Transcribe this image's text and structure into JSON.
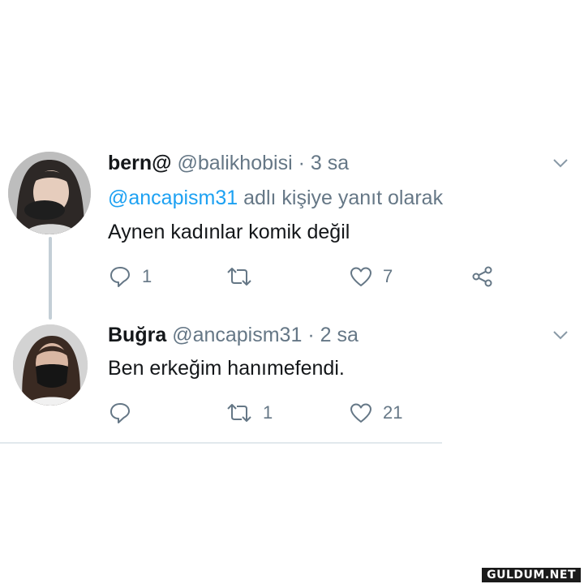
{
  "tweets": [
    {
      "name": "bern@",
      "handle": "@balikhobisi",
      "separator": "·",
      "time": "3 sa",
      "reply_mention": "@ancapism31",
      "reply_suffix": "adlı kişiye yanıt olarak",
      "text": "Aynen kadınlar komik değil",
      "actions": {
        "reply_count": "1",
        "retweet_count": "",
        "like_count": "7"
      }
    },
    {
      "name": "Buğra",
      "handle": "@ancapism31",
      "separator": "·",
      "time": "2 sa",
      "text": "Ben erkeğim hanımefendi.",
      "actions": {
        "reply_count": "",
        "retweet_count": "1",
        "like_count": "21"
      }
    }
  ],
  "watermark": "GULDUM.NET",
  "colors": {
    "name": "#14171a",
    "muted": "#657786",
    "mention": "#1da1f2",
    "thread_line": "#c4cfd6"
  }
}
